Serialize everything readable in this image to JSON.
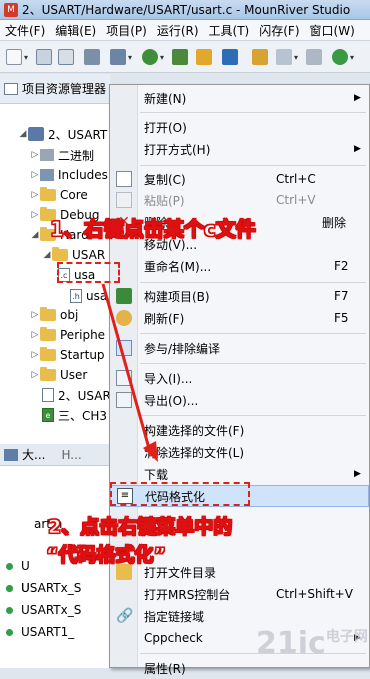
{
  "window": {
    "title": "2、USART/Hardware/USART/usart.c - MounRiver Studio"
  },
  "menubar": [
    "文件(F)",
    "编辑(E)",
    "项目(P)",
    "运行(R)",
    "工具(T)",
    "闪存(F)",
    "窗口(W)"
  ],
  "explorer": {
    "tab_title": "项目资源管理器",
    "items": [
      {
        "label": "2、USART",
        "kind": "project"
      },
      {
        "label": "二进制",
        "kind": "bin"
      },
      {
        "label": "Includes",
        "kind": "inc"
      },
      {
        "label": "Core",
        "kind": "folder"
      },
      {
        "label": "Debug",
        "kind": "folder"
      },
      {
        "label": "Hard",
        "kind": "folder"
      },
      {
        "label": "USAR",
        "kind": "folder"
      },
      {
        "label": "usa",
        "kind": "c"
      },
      {
        "label": "usa",
        "kind": "h"
      },
      {
        "label": "obj",
        "kind": "folder"
      },
      {
        "label": "Periphe",
        "kind": "folder"
      },
      {
        "label": "Startup",
        "kind": "folder"
      },
      {
        "label": "User",
        "kind": "folder"
      },
      {
        "label": "2、USAR",
        "kind": "file"
      },
      {
        "label": "三、CH3",
        "kind": "file"
      }
    ]
  },
  "outline": {
    "tab_title": "大...",
    "tab2": "H...",
    "items": [
      "art.h",
      "U",
      "U",
      "USARTx_S",
      "USARTx_S",
      "USART1_"
    ]
  },
  "context_menu": {
    "items": [
      {
        "label": "新建(N)",
        "shortcut": "",
        "submenu": true,
        "disabled": false,
        "icon": ""
      },
      {
        "label": "打开(O)",
        "shortcut": "",
        "submenu": false,
        "disabled": false,
        "icon": ""
      },
      {
        "label": "打开方式(H)",
        "shortcut": "",
        "submenu": true,
        "disabled": false,
        "icon": ""
      },
      {
        "label": "复制(C)",
        "shortcut": "Ctrl+C",
        "submenu": false,
        "disabled": false,
        "icon": "copy-icon"
      },
      {
        "label": "粘贴(P)",
        "shortcut": "Ctrl+V",
        "submenu": false,
        "disabled": true,
        "icon": "paste-icon"
      },
      {
        "label": "删除",
        "shortcut": "删除",
        "submenu": false,
        "disabled": false,
        "icon": "delete-icon"
      },
      {
        "label": "移动(V)...",
        "shortcut": "",
        "submenu": false,
        "disabled": false,
        "icon": ""
      },
      {
        "label": "重命名(M)...",
        "shortcut": "F2",
        "submenu": false,
        "disabled": false,
        "icon": ""
      },
      {
        "label": "构建项目(B)",
        "shortcut": "F7",
        "submenu": false,
        "disabled": false,
        "icon": "build-icon"
      },
      {
        "label": "刷新(F)",
        "shortcut": "F5",
        "submenu": false,
        "disabled": false,
        "icon": "refresh-icon"
      },
      {
        "label": "参与/排除编译",
        "shortcut": "",
        "submenu": false,
        "disabled": false,
        "icon": "exclude-icon"
      },
      {
        "label": "导入(I)...",
        "shortcut": "",
        "submenu": false,
        "disabled": false,
        "icon": "import-icon"
      },
      {
        "label": "导出(O)...",
        "shortcut": "",
        "submenu": false,
        "disabled": false,
        "icon": "export-icon"
      },
      {
        "label": "构建选择的文件(F)",
        "shortcut": "",
        "submenu": false,
        "disabled": false,
        "icon": ""
      },
      {
        "label": "清除选择的文件(L)",
        "shortcut": "",
        "submenu": false,
        "disabled": false,
        "icon": ""
      },
      {
        "label": "下载",
        "shortcut": "",
        "submenu": true,
        "disabled": false,
        "icon": ""
      },
      {
        "label": "代码格式化",
        "shortcut": "",
        "submenu": false,
        "disabled": false,
        "icon": "format-icon"
      },
      {
        "label": "打开文件目录",
        "shortcut": "",
        "submenu": false,
        "disabled": false,
        "icon": "folder-icon"
      },
      {
        "label": "打开MRS控制台",
        "shortcut": "Ctrl+Shift+V",
        "submenu": false,
        "disabled": false,
        "icon": ""
      },
      {
        "label": "指定链接域",
        "shortcut": "",
        "submenu": false,
        "disabled": false,
        "icon": "link-icon"
      },
      {
        "label": "Cppcheck",
        "shortcut": "",
        "submenu": true,
        "disabled": false,
        "icon": ""
      },
      {
        "label": "属性(R)",
        "shortcut": "",
        "submenu": false,
        "disabled": false,
        "icon": ""
      }
    ]
  },
  "annotations": {
    "step1": "1、右键点击某个c文件",
    "step2_line1": "2、点击右键菜单中的",
    "step2_line2": "“代码格式化”"
  },
  "watermark": {
    "text": "21ic",
    "sub": "电子网"
  },
  "colors": {
    "annotation": "#e0201b",
    "highlight": "#cfe3fb"
  }
}
